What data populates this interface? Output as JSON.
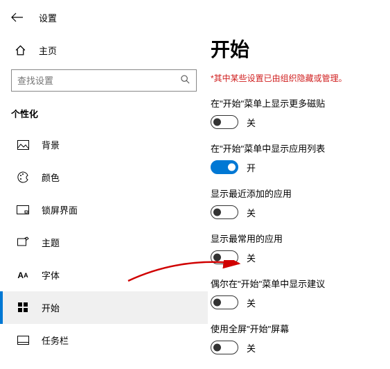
{
  "header": {
    "app_title": "设置"
  },
  "home": {
    "label": "主页"
  },
  "search": {
    "placeholder": "查找设置"
  },
  "section_label": "个性化",
  "nav": {
    "items": [
      {
        "label": "背景"
      },
      {
        "label": "颜色"
      },
      {
        "label": "锁屏界面"
      },
      {
        "label": "主题"
      },
      {
        "label": "字体"
      },
      {
        "label": "开始"
      },
      {
        "label": "任务栏"
      }
    ]
  },
  "page": {
    "title": "开始",
    "warning": "*其中某些设置已由组织隐藏或管理。"
  },
  "settings": [
    {
      "label": "在\"开始\"菜单上显示更多磁贴",
      "state": "关",
      "on": false
    },
    {
      "label": "在\"开始\"菜单中显示应用列表",
      "state": "开",
      "on": true
    },
    {
      "label": "显示最近添加的应用",
      "state": "关",
      "on": false
    },
    {
      "label": "显示最常用的应用",
      "state": "关",
      "on": false
    },
    {
      "label": "偶尔在\"开始\"菜单中显示建议",
      "state": "关",
      "on": false
    },
    {
      "label": "使用全屏\"开始\"屏幕",
      "state": "关",
      "on": false
    }
  ]
}
